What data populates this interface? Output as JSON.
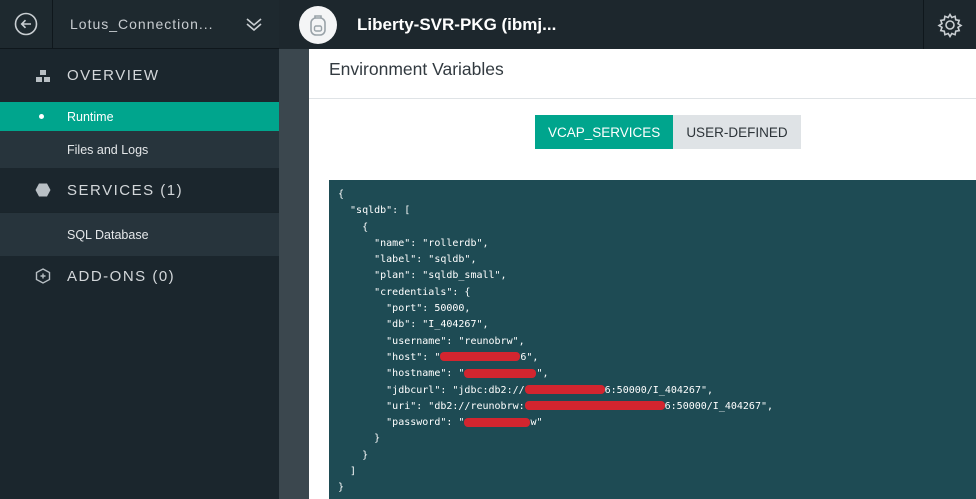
{
  "sidebar": {
    "space_name": "Lotus_Connection...",
    "sections": [
      {
        "label": "OVERVIEW",
        "icon": "overview-icon"
      },
      {
        "label": "SERVICES (1)",
        "icon": "services-hexagon-icon"
      },
      {
        "label": "ADD-ONS (0)",
        "icon": "addons-icon"
      }
    ],
    "overview_items": [
      "Runtime",
      "Files and Logs"
    ],
    "services_items": [
      "SQL Database"
    ]
  },
  "header": {
    "app_title": "Liberty-SVR-PKG (ibmj..."
  },
  "main": {
    "title": "Environment Variables",
    "tabs": [
      "VCAP_SERVICES",
      "USER-DEFINED"
    ],
    "active_tab": "VCAP_SERVICES",
    "code": {
      "l1": "{",
      "l2": "  \"sqldb\": [",
      "l3": "    {",
      "l4": "      \"name\": \"rollerdb\",",
      "l5": "      \"label\": \"sqldb\",",
      "l6": "      \"plan\": \"sqldb_small\",",
      "l7": "      \"credentials\": {",
      "l8": "        \"port\": 50000,",
      "l9": "        \"db\": \"I_404267\",",
      "l10": "        \"username\": \"reunobrw\",",
      "l11a": "        \"host\": \"",
      "l11b": "6\",",
      "l12a": "        \"hostname\": \"",
      "l12b": "\",",
      "l13a": "        \"jdbcurl\": \"jdbc:db2://",
      "l13b": "6:50000/I_404267\",",
      "l14a": "        \"uri\": \"db2://reunobrw:",
      "l14b": "6:50000/I_404267\",",
      "l15a": "        \"password\": \"",
      "l15b": "w\"",
      "l16": "      }",
      "l17": "    }",
      "l18": "  ]",
      "l19": "}"
    }
  },
  "colors": {
    "accent": "#00a58d",
    "sidebar_bg": "#1b262d",
    "code_bg": "#1e4b54",
    "redaction": "#e3222c"
  }
}
